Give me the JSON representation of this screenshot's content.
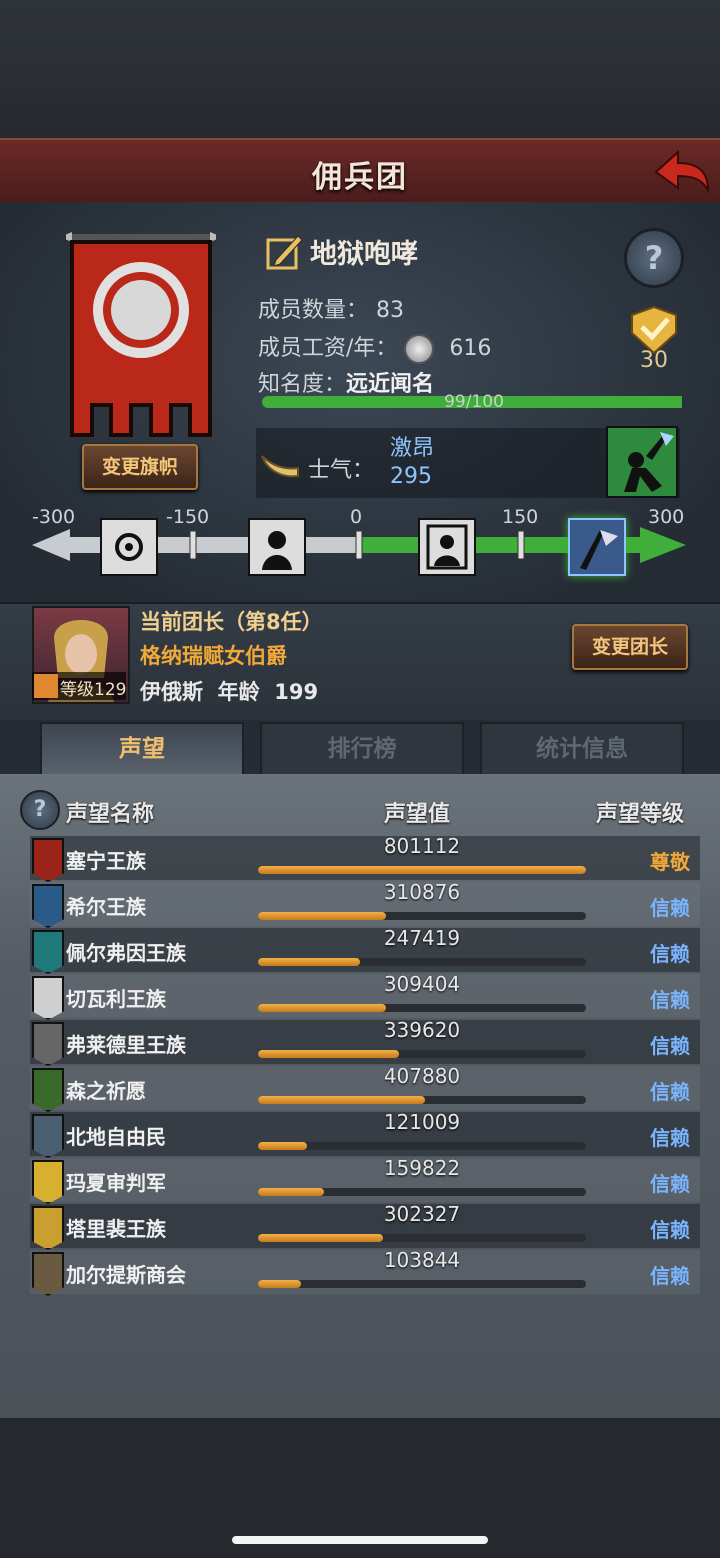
{
  "header": {
    "title": "佣兵团"
  },
  "team": {
    "name": "地狱咆哮",
    "members_label": "成员数量：",
    "members_value": "83",
    "salary_label": "成员工资/年：",
    "salary_value": "616",
    "fame_label": "知名度：",
    "fame_title": "远近闻名",
    "fame_progress_text": "99/100",
    "fame_progress": 0.99,
    "medal_value": "30",
    "change_banner_label": "变更旗帜"
  },
  "morale": {
    "label": "士气：",
    "state": "激昂",
    "value": "295",
    "scale_ticks": [
      "-300",
      "-150",
      "0",
      "150",
      "300"
    ]
  },
  "leader": {
    "title": "当前团长（第8任）",
    "name": "格纳瑞赋女伯爵",
    "level_label": "等级129",
    "race_age": "伊俄斯  年龄  199",
    "change_leader_label": "变更团长"
  },
  "tabs": [
    {
      "label": "声望"
    },
    {
      "label": "排行榜"
    },
    {
      "label": "统计信息"
    }
  ],
  "list": {
    "col_name": "声望名称",
    "col_value": "声望值",
    "col_level": "声望等级",
    "rows": [
      {
        "name": "塞宁王族",
        "value": "801112",
        "level": "尊敬",
        "fill": 1.0,
        "icon": "red-banner-icon"
      },
      {
        "name": "希尔王族",
        "value": "310876",
        "level": "信赖",
        "fill": 0.39,
        "icon": "blue-banner-icon"
      },
      {
        "name": "佩尔弗因王族",
        "value": "247419",
        "level": "信赖",
        "fill": 0.31,
        "icon": "teal-banner-icon"
      },
      {
        "name": "切瓦利王族",
        "value": "309404",
        "level": "信赖",
        "fill": 0.39,
        "icon": "white-banner-icon"
      },
      {
        "name": "弗莱德里王族",
        "value": "339620",
        "level": "信赖",
        "fill": 0.43,
        "icon": "grey-banner-icon"
      },
      {
        "name": "森之祈愿",
        "value": "407880",
        "level": "信赖",
        "fill": 0.51,
        "icon": "tree-banner-icon"
      },
      {
        "name": "北地自由民",
        "value": "121009",
        "level": "信赖",
        "fill": 0.15,
        "icon": "axe-banner-icon"
      },
      {
        "name": "玛夏审判军",
        "value": "159822",
        "level": "信赖",
        "fill": 0.2,
        "icon": "yellow-chevron-banner-icon"
      },
      {
        "name": "塔里裴王族",
        "value": "302327",
        "level": "信赖",
        "fill": 0.38,
        "icon": "crown-banner-icon"
      },
      {
        "name": "加尔提斯商会",
        "value": "103844",
        "level": "信赖",
        "fill": 0.13,
        "icon": "chest-banner-icon"
      }
    ]
  },
  "colors": {
    "level_respect": "#f0a838",
    "level_trust": "#7ab4ff",
    "bar_fill": "#e3962c",
    "fame_bar": "#3fae3a"
  }
}
